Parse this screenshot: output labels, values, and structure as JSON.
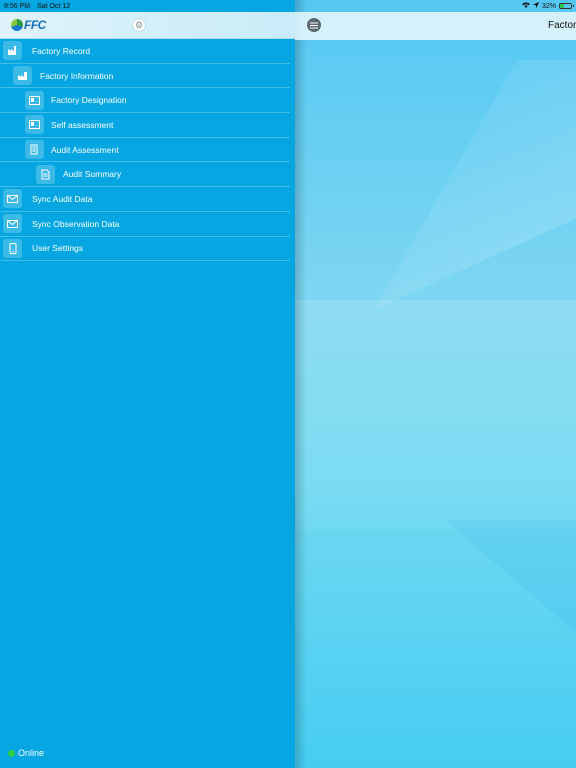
{
  "status_bar": {
    "time": "9:56 PM",
    "date": "Sat Oct 12",
    "battery_percent": "32%",
    "battery_level": 0.32,
    "icons": [
      "wifi-icon",
      "location-icon",
      "battery-icon"
    ]
  },
  "sidebar": {
    "logo_text": "FFC",
    "settings_icon": "gear-icon",
    "items": [
      {
        "label": "Factory Record",
        "icon": "factory-icon",
        "level": 0
      },
      {
        "label": "Factory Information",
        "icon": "factory-info-icon",
        "level": 1
      },
      {
        "label": "Factory Designation",
        "icon": "designation-icon",
        "level": 2
      },
      {
        "label": "Self assessment",
        "icon": "self-assessment-icon",
        "level": 2
      },
      {
        "label": "Audit Assessment",
        "icon": "audit-assessment-icon",
        "level": 2
      },
      {
        "label": "Audit Summary",
        "icon": "document-icon",
        "level": 3
      },
      {
        "label": "Sync Audit Data",
        "icon": "sync-mail-icon",
        "level": 0
      },
      {
        "label": "Sync Observation Data",
        "icon": "sync-mail-icon",
        "level": 0
      },
      {
        "label": "User Settings",
        "icon": "phone-settings-icon",
        "level": 0
      }
    ],
    "status": {
      "label": "Online",
      "color": "#2ecc40"
    }
  },
  "main": {
    "title": "Factory",
    "menu_icon": "hamburger-icon"
  },
  "colors": {
    "sidebar_bg": "#05a6e1",
    "header_bg": "#dff3fa",
    "logo_blue": "#1b6fb8"
  }
}
